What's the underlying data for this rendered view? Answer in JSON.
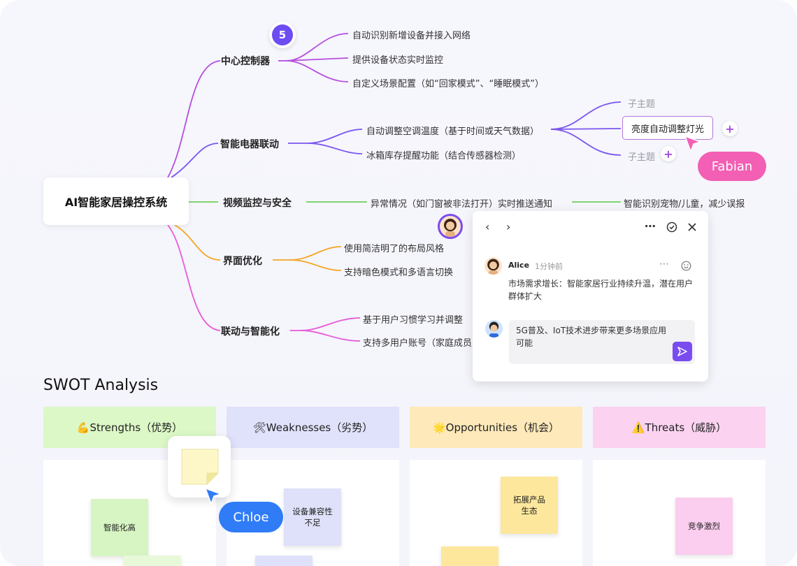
{
  "mindmap": {
    "root": "AI智能家居操控系统",
    "branches": [
      {
        "label": "中心控制器",
        "leaves": [
          "自动识别新增设备并接入网络",
          "提供设备状态实时监控",
          "自定义场景配置（如“回家模式”、“睡眠模式”）"
        ]
      },
      {
        "label": "智能电器联动",
        "leaves": [
          "自动调整空调温度（基于时间或天气数据）",
          "冰箱库存提醒功能（结合传感器检测）"
        ]
      },
      {
        "label": "视频监控与安全",
        "leaves": [
          "异常情况（如门窗被非法打开）实时推送通知"
        ]
      },
      {
        "label": "界面优化",
        "leaves": [
          "使用简洁明了的布局风格",
          "支持暗色模式和多语言切换"
        ]
      },
      {
        "label": "联动与智能化",
        "leaves": [
          "基于用户习惯学习并调整",
          "支持多用户账号（家庭成员"
        ]
      }
    ],
    "sub_nodes": {
      "top": "子主题",
      "selected": "亮度自动调整灯光",
      "bottom": "子主题",
      "security_child": "智能识别宠物/儿童，减少误报"
    },
    "badge_count": "5"
  },
  "cursors": {
    "fabian": {
      "name": "Fabian",
      "color": "#f25fb4"
    },
    "chloe": {
      "name": "Chloe",
      "color": "#2f7cf6"
    }
  },
  "comment_panel": {
    "author": "Alice",
    "time": "1分钟前",
    "text": "市场需求增长：智能家居行业持续升温，潜在用户群体扩大",
    "reply_draft": "5G普及、IoT技术进步带来更多场景应用可能",
    "icons": [
      "chevron-left-icon",
      "chevron-right-icon",
      "more-icon",
      "check-circle-icon",
      "close-icon",
      "more-icon",
      "emoji-icon",
      "send-icon"
    ]
  },
  "swot": {
    "title": "SWOT Analysis",
    "columns": [
      {
        "icon": "💪",
        "label": "Strengths（优势）",
        "color": "#dcf8c6",
        "notes": [
          "智能化高"
        ]
      },
      {
        "icon": "🛠",
        "label": "Weaknesses（劣势）",
        "color": "#e0e2fb",
        "notes": [
          "设备兼容性不足"
        ]
      },
      {
        "icon": "🌟",
        "label": "Opportunities（机会）",
        "color": "#fde9b9",
        "notes": [
          "拓展产品生态"
        ]
      },
      {
        "icon": "⚠️",
        "label": "Threats（威胁）",
        "color": "#fbd3f0",
        "notes": [
          "竞争激烈"
        ]
      }
    ]
  },
  "colors": {
    "purple": "#a64be0",
    "violet": "#7a55ef",
    "green": "#6fd05a",
    "orange": "#f5a623",
    "pink": "#e85ad8"
  }
}
